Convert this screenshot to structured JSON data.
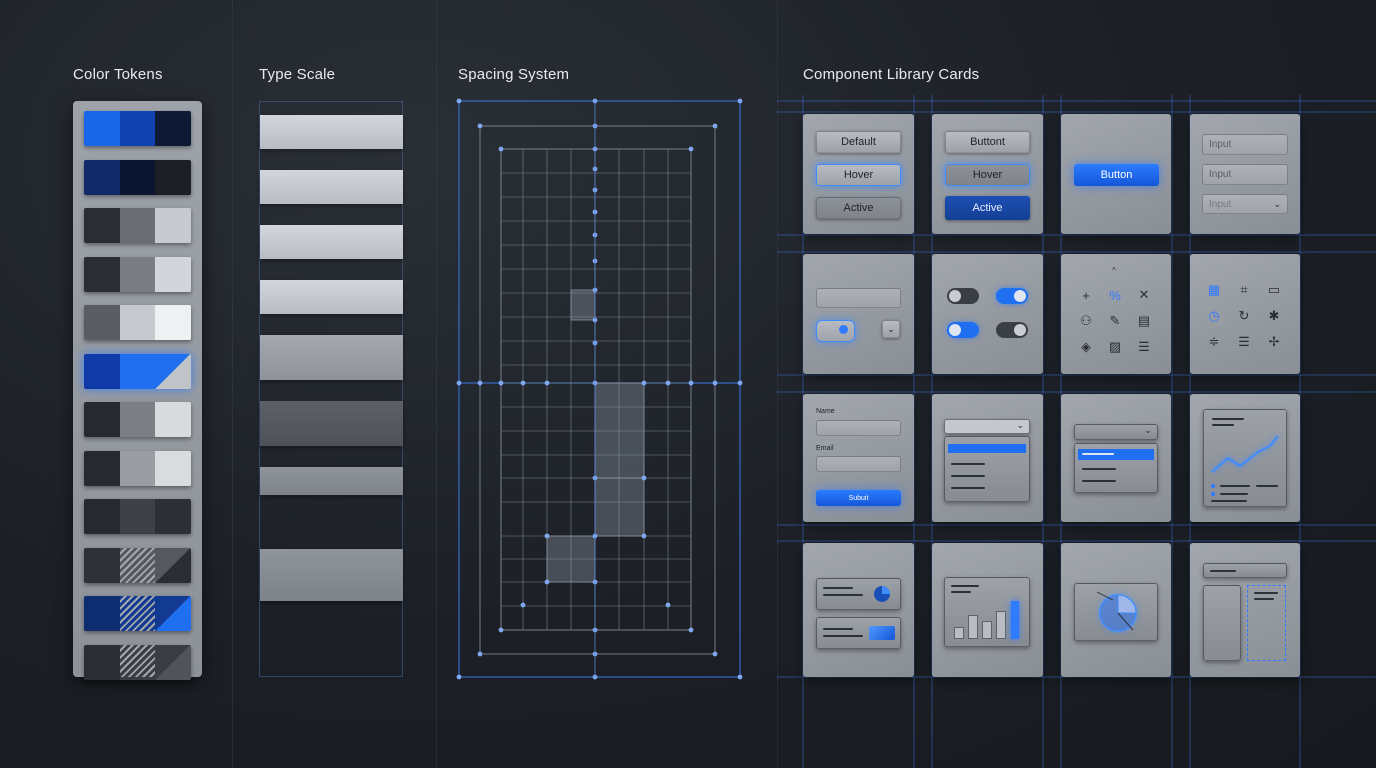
{
  "sections": {
    "color_tokens": "Color Tokens",
    "type_scale": "Type Scale",
    "spacing_system": "Spacing System",
    "component_library": "Component Library Cards"
  },
  "color_tokens": [
    [
      "#1a66e8",
      "#1043b0",
      "#0e1a33"
    ],
    [
      "#0f2a66",
      "#0b1630",
      "#1c1f24"
    ],
    [
      "#2a2e34",
      "#6a6e74",
      "#c7cacf"
    ],
    [
      "#2a2e34",
      "#7a7e84",
      "#d2d5da"
    ],
    [
      "#5a5e64",
      "#c6c9ce",
      "#eef0f2"
    ],
    [
      "#0f3aa8",
      "#1f6ff0",
      "#c0c4c9"
    ],
    [
      "#26292e",
      "#7c8086",
      "#d8dade"
    ],
    [
      "#26292e",
      "#9a9ea4",
      "#d9dbdf"
    ],
    [
      "#26292e",
      "#3e4248",
      "#2c3036"
    ],
    [
      "#2e3238",
      "#55595f",
      "#2a2e34"
    ],
    [
      "#0e2c70",
      "#123a90",
      "#1f6ff0"
    ],
    [
      "#2a2e34",
      "#3a3e44",
      "#50545a"
    ]
  ],
  "buttons": {
    "default": "Default",
    "hover": "Hover",
    "active": "Active",
    "buttont": "Buttont",
    "button": "Button"
  },
  "inputs": {
    "placeholder": "Input"
  },
  "form": {
    "name_label": "Name",
    "email_label": "Email",
    "submit_label": "Subuit"
  },
  "icons": {
    "grid_1": [
      "plus-icon",
      "percent-icon",
      "close-icon",
      "group-icon",
      "pencil-icon",
      "media-icon",
      "tag-icon",
      "image-icon",
      "list-icon"
    ],
    "grid_2": [
      "grid-icon",
      "nodes-icon",
      "panel-icon",
      "clock-icon",
      "refresh-icon",
      "settings-icon",
      "sliders-icon",
      "list-icon",
      "sparkle-icon"
    ]
  },
  "accent_color": "#2f7bff"
}
